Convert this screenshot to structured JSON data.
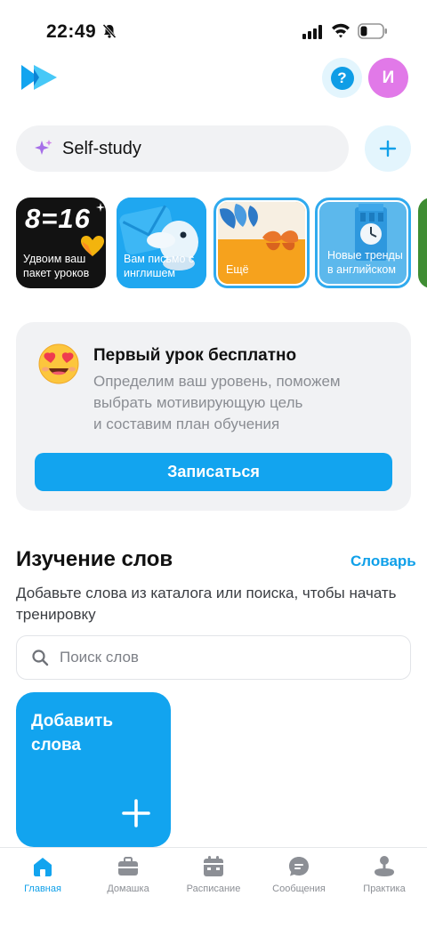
{
  "status_bar": {
    "time": "22:49"
  },
  "header": {
    "help_label": "?",
    "avatar_initial": "И"
  },
  "self_study": {
    "label": "Self-study"
  },
  "stories": [
    {
      "big_text": "8=16",
      "label": "Удвоим ваш пакет уроков"
    },
    {
      "label": "Вам письмо с инглишем"
    },
    {
      "label": "Ещё"
    },
    {
      "label": "Новые тренды в английском"
    }
  ],
  "trial": {
    "title": "Первый урок бесплатно",
    "desc_lines": [
      "Определим ваш уровень, поможем",
      "выбрать мотивирующую цель",
      "и составим план обучения"
    ],
    "button": "Записаться"
  },
  "words": {
    "title": "Изучение слов",
    "dictionary_link": "Словарь",
    "description": "Добавьте слова из каталога или поиска, чтобы начать тренировку",
    "search_placeholder": "Поиск слов",
    "add_card": "Добавить слова"
  },
  "nav": {
    "items": [
      {
        "label": "Главная",
        "icon": "home-icon",
        "active": true
      },
      {
        "label": "Домашка",
        "icon": "briefcase-icon"
      },
      {
        "label": "Расписание",
        "icon": "calendar-icon"
      },
      {
        "label": "Сообщения",
        "icon": "chat-icon"
      },
      {
        "label": "Практика",
        "icon": "joystick-icon"
      }
    ]
  },
  "colors": {
    "accent": "#12a4ef",
    "avatar": "#e179e8",
    "card_bg": "#f1f2f4"
  }
}
